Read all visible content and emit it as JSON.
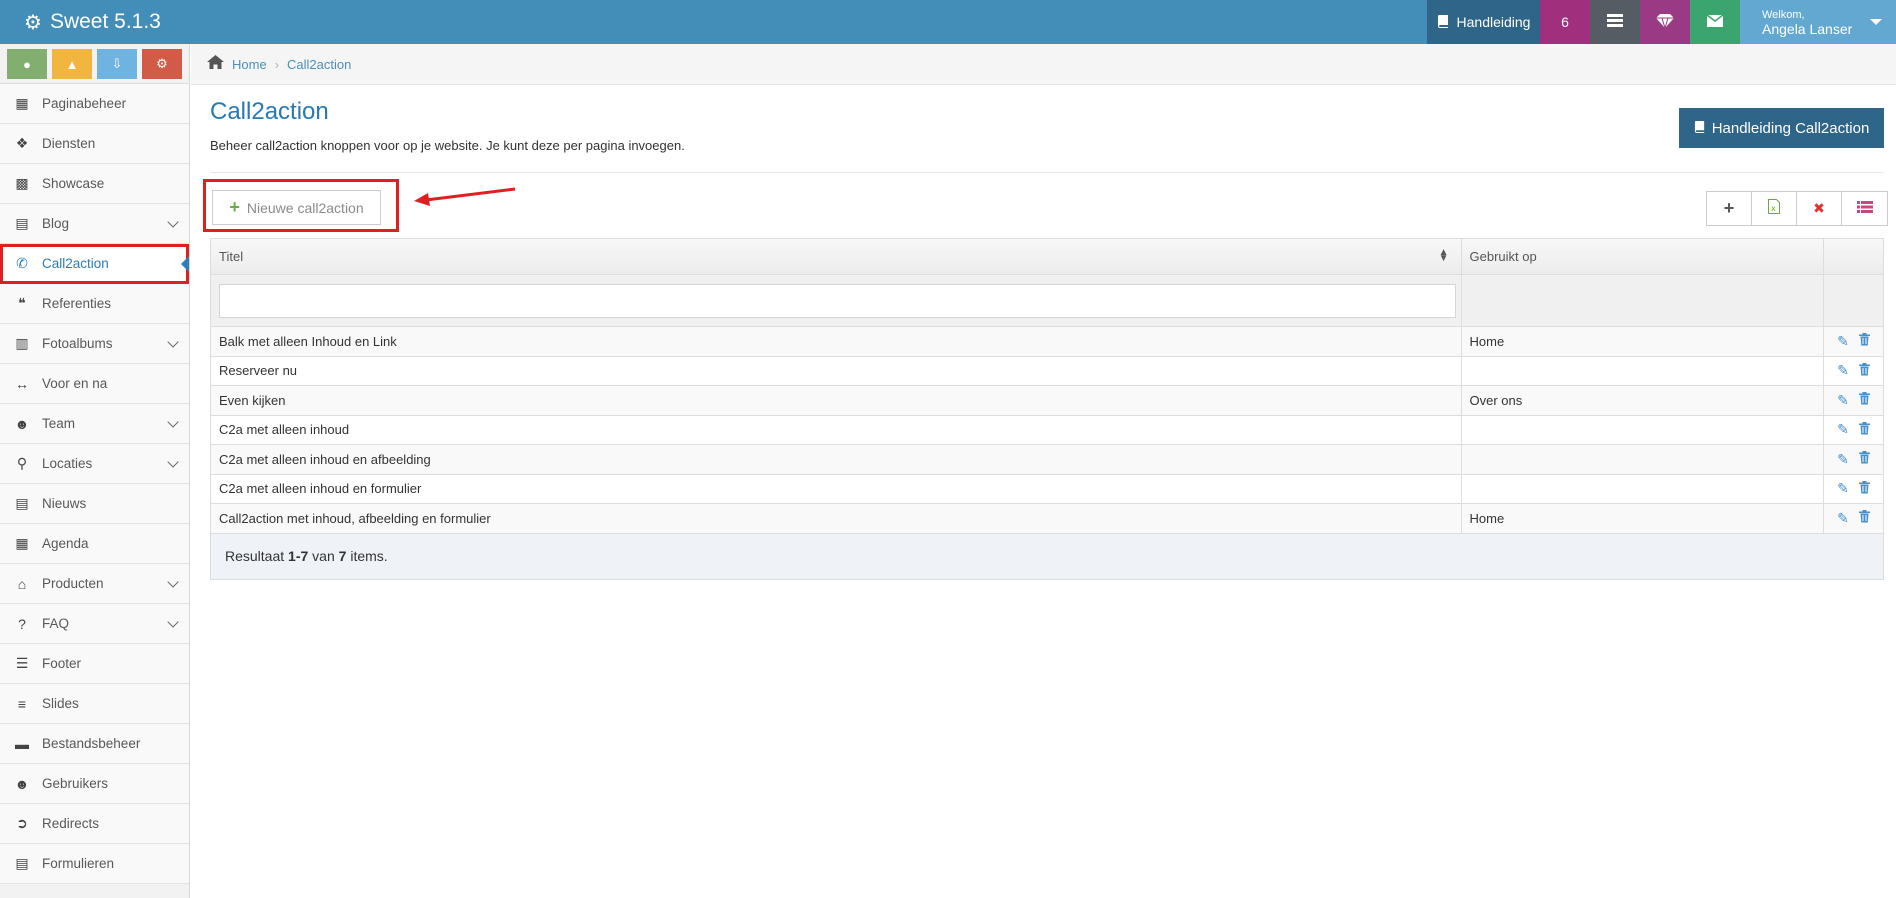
{
  "app": {
    "title": "Sweet 5.1.3"
  },
  "topbar": {
    "manual_label": "Handleiding",
    "count": "6",
    "welcome_label": "Welkom,",
    "user_name": "Angela Lanser"
  },
  "sidebar": {
    "items": [
      {
        "label": "Paginabeheer",
        "icon": "table-icon",
        "expandable": false
      },
      {
        "label": "Diensten",
        "icon": "cubes-icon",
        "expandable": false
      },
      {
        "label": "Showcase",
        "icon": "grid-icon",
        "expandable": false
      },
      {
        "label": "Blog",
        "icon": "file-icon",
        "expandable": true
      },
      {
        "label": "Call2action",
        "icon": "phone-icon",
        "expandable": false,
        "active": true
      },
      {
        "label": "Referenties",
        "icon": "comments-icon",
        "expandable": false
      },
      {
        "label": "Fotoalbums",
        "icon": "book-icon",
        "expandable": true
      },
      {
        "label": "Voor en na",
        "icon": "arrows-h-icon",
        "expandable": false
      },
      {
        "label": "Team",
        "icon": "users-icon",
        "expandable": true
      },
      {
        "label": "Locaties",
        "icon": "map-marker-icon",
        "expandable": true
      },
      {
        "label": "Nieuws",
        "icon": "newspaper-icon",
        "expandable": false
      },
      {
        "label": "Agenda",
        "icon": "calendar-icon",
        "expandable": false
      },
      {
        "label": "Producten",
        "icon": "tags-icon",
        "expandable": true
      },
      {
        "label": "FAQ",
        "icon": "question-icon",
        "expandable": true
      },
      {
        "label": "Footer",
        "icon": "list-alt-icon",
        "expandable": false
      },
      {
        "label": "Slides",
        "icon": "sliders-icon",
        "expandable": false
      },
      {
        "label": "Bestandsbeheer",
        "icon": "folder-open-icon",
        "expandable": false
      },
      {
        "label": "Gebruikers",
        "icon": "user-icon",
        "expandable": false
      },
      {
        "label": "Redirects",
        "icon": "arrow-circle-icon",
        "expandable": false
      },
      {
        "label": "Formulieren",
        "icon": "form-icon",
        "expandable": false
      }
    ]
  },
  "breadcrumb": {
    "home": "Home",
    "current": "Call2action"
  },
  "page": {
    "title": "Call2action",
    "description": "Beheer call2action knoppen voor op je website. Je kunt deze per pagina invoegen.",
    "manual_button": "Handleiding Call2action",
    "new_button": "Nieuwe call2action"
  },
  "table": {
    "columns": [
      "Titel",
      "Gebruikt op"
    ],
    "rows": [
      {
        "title": "Balk met alleen Inhoud en Link",
        "used_on": "Home"
      },
      {
        "title": "Reserveer nu",
        "used_on": ""
      },
      {
        "title": "Even kijken",
        "used_on": "Over ons"
      },
      {
        "title": "C2a met alleen inhoud",
        "used_on": ""
      },
      {
        "title": "C2a met alleen inhoud en afbeelding",
        "used_on": ""
      },
      {
        "title": "C2a met alleen inhoud en formulier",
        "used_on": ""
      },
      {
        "title": "Call2action met inhoud, afbeelding en formulier",
        "used_on": "Home"
      }
    ],
    "footer": {
      "prefix": "Resultaat",
      "range": "1-7",
      "middle": "van",
      "total": "7",
      "suffix": "items."
    }
  },
  "colors": {
    "topbar": "#438eb9",
    "accent": "#2679b5",
    "highlight": "#e02020"
  }
}
